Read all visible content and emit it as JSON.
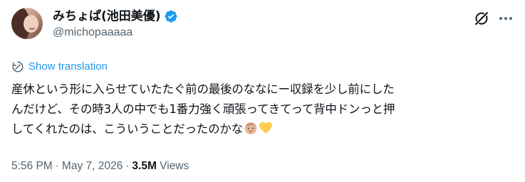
{
  "author": {
    "display_name": "みちょぱ(池田美優)",
    "handle": "@michopaaaaa"
  },
  "translate": {
    "label": "Show translation"
  },
  "tweet": {
    "lines": [
      "産休という形に入らせていたたぐ前の最後のななにー収録を少し前にした",
      "んだけど、その時3人の中でも1番力強く頑張ってきてって背中ドンっと押",
      "してくれたのは、こういうことだったのかな"
    ],
    "emojis": [
      "baby-emoji",
      "yellow-heart-emoji"
    ]
  },
  "meta": {
    "time": "5:56 PM",
    "date": "May 7, 2026",
    "views_count": "3.5M",
    "views_label": "Views",
    "separator": "·"
  },
  "colors": {
    "accent": "#1d9bf0",
    "secondary_text": "#536471",
    "primary_text": "#0f1419",
    "heart": "#ffcc4d"
  },
  "icons": [
    "verified-badge-icon",
    "grok-icon",
    "more-options-icon",
    "translate-icon"
  ]
}
